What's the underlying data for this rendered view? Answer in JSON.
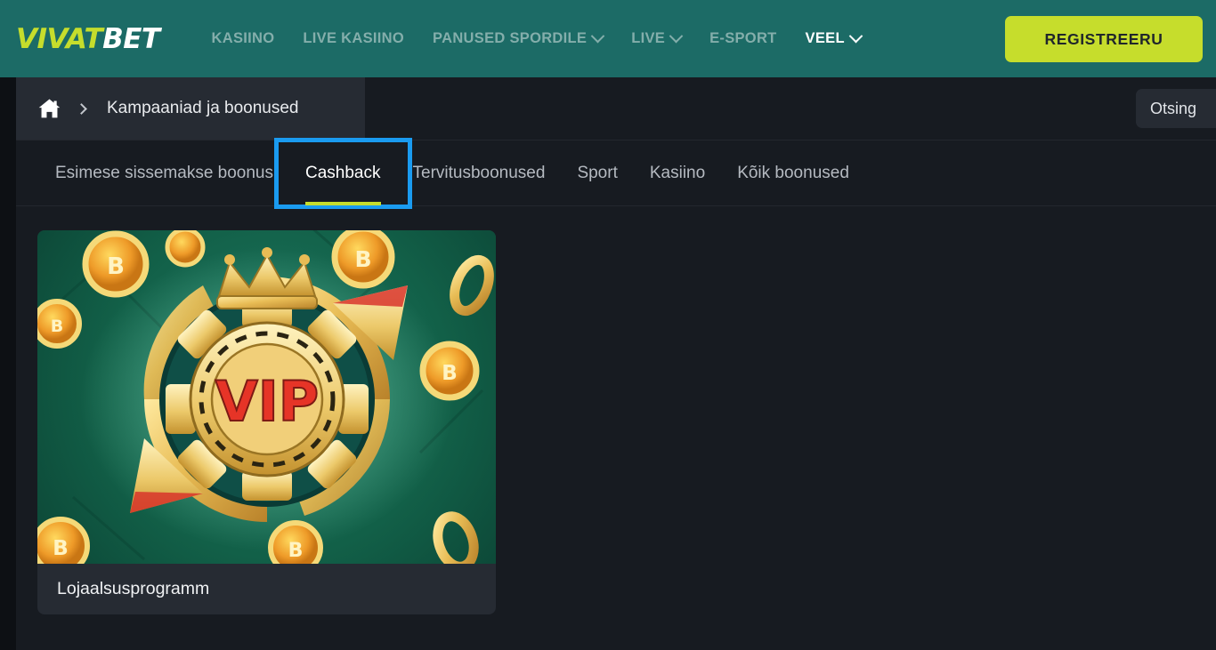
{
  "header": {
    "logo_primary": "VIVAT",
    "logo_secondary": "BET",
    "nav": [
      {
        "label": "KASIINO",
        "has_chevron": false,
        "bright": false
      },
      {
        "label": "LIVE KASIINO",
        "has_chevron": false,
        "bright": false
      },
      {
        "label": "PANUSED SPORDILE",
        "has_chevron": true,
        "bright": false
      },
      {
        "label": "LIVE",
        "has_chevron": true,
        "bright": false
      },
      {
        "label": "E-SPORT",
        "has_chevron": false,
        "bright": false
      },
      {
        "label": "VEEL",
        "has_chevron": true,
        "bright": true
      }
    ],
    "register_label": "REGISTREERU",
    "colors": {
      "header_bg": "#1c6b66",
      "accent_lime": "#c6dd2c",
      "nav_text": "#84aeab"
    }
  },
  "breadcrumb": {
    "home_icon": "home-icon",
    "separator_icon": "chevron-right-icon",
    "current": "Kampaaniad ja boonused"
  },
  "search": {
    "label": "Otsing",
    "placeholder": "Otsing"
  },
  "tabs": [
    {
      "label": "Esimese sissemakse boonus",
      "active": false,
      "highlighted": false
    },
    {
      "label": "Cashback",
      "active": true,
      "highlighted": true
    },
    {
      "label": "Tervitusboonused",
      "active": false,
      "highlighted": false
    },
    {
      "label": "Sport",
      "active": false,
      "highlighted": false
    },
    {
      "label": "Kasiino",
      "active": false,
      "highlighted": false
    },
    {
      "label": "Kõik boonused",
      "active": false,
      "highlighted": false
    }
  ],
  "highlight": {
    "color": "#1a9bf0",
    "target": "Cashback"
  },
  "cards": [
    {
      "title": "Lojaalsusprogramm",
      "image_alt": "vip-casino-chip-banner",
      "image_text": "VIP"
    }
  ],
  "colors": {
    "page_bg": "#0d1014",
    "content_bg": "#171b21",
    "panel_bg": "#262b33",
    "text_primary": "#e9ebee",
    "text_muted": "#b5bac1"
  }
}
